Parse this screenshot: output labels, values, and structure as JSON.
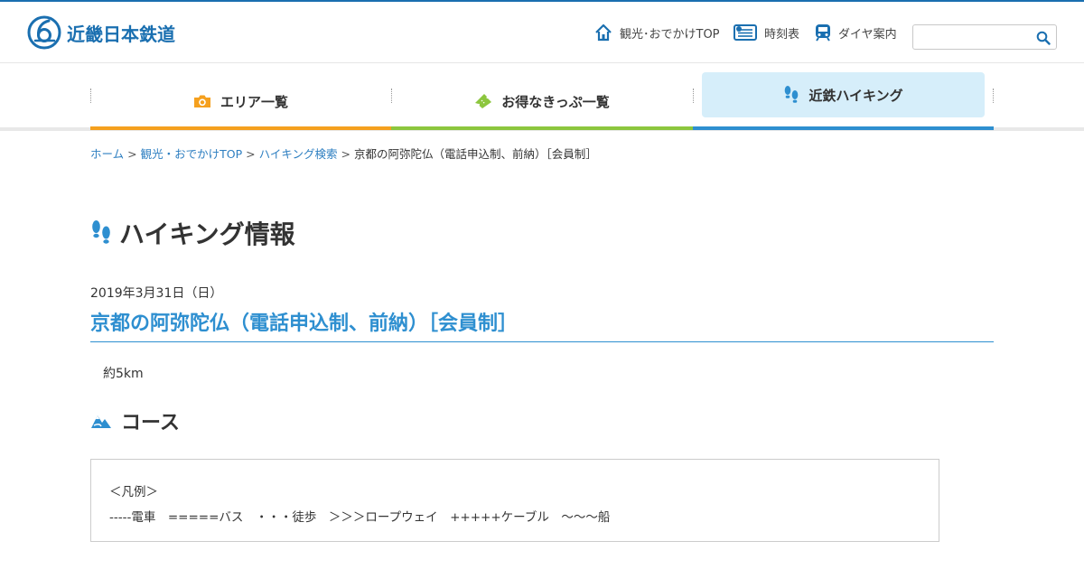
{
  "header": {
    "logo_text": "近畿日本鉄道",
    "links": [
      {
        "label": "観光･おでかけTOP",
        "icon": "house-icon"
      },
      {
        "label": "時刻表",
        "icon": "timetable-icon"
      },
      {
        "label": "ダイヤ案内",
        "icon": "train-icon"
      }
    ],
    "search": {
      "placeholder": "",
      "value": ""
    }
  },
  "main_nav": {
    "tabs": [
      {
        "label": "エリア一覧",
        "icon": "camera-icon",
        "color": "#f5a01e"
      },
      {
        "label": "お得なきっぷ一覧",
        "icon": "ticket-icon",
        "color": "#8cc63e"
      },
      {
        "label": "近鉄ハイキング",
        "icon": "footprints-icon",
        "color": "#2e8fd0",
        "active": true
      }
    ]
  },
  "breadcrumb": {
    "items": [
      "ホーム",
      "観光・おでかけTOP",
      "ハイキング検索"
    ],
    "current": "京都の阿弥陀仏（電話申込制、前納）［会員制］",
    "separator": ">"
  },
  "page": {
    "heading": "ハイキング情報",
    "date": "2019年3月31日（日）",
    "event_title": "京都の阿弥陀仏（電話申込制、前納）［会員制］",
    "distance": "約5km",
    "course_heading": "コース",
    "legend_title": "＜凡例＞",
    "legend_line": "-----電車　=====バス　・・・徒歩　＞＞＞ロープウェイ　+++++ケーブル　〜〜〜船"
  },
  "colors": {
    "brand_blue": "#1a6fb0",
    "accent_blue": "#2e8fd0",
    "link": "#2e7fc1",
    "orange": "#f5a01e",
    "green": "#8cc63e",
    "active_tab_bg": "#d6eefa"
  }
}
